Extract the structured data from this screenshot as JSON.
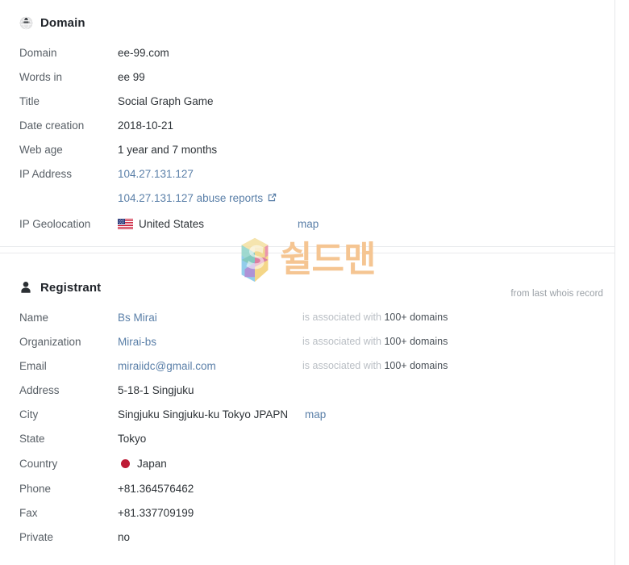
{
  "domain_section": {
    "title": "Domain",
    "icon": "globe-icon",
    "rows": [
      {
        "label": "Domain",
        "value": "ee-99.com"
      },
      {
        "label": "Words in",
        "value": "ee 99"
      },
      {
        "label": "Title",
        "value": "Social Graph Game"
      },
      {
        "label": "Date creation",
        "value": "2018-10-21"
      },
      {
        "label": "Web age",
        "value": "1 year and 7 months"
      }
    ],
    "ip": {
      "label": "IP Address",
      "address": "104.27.131.127",
      "abuse_link": "104.27.131.127 abuse reports",
      "external_icon": "external-link-icon"
    },
    "geolocation": {
      "label": "IP Geolocation",
      "country": "United States",
      "flag": "flag-united-states",
      "map_link": "map"
    }
  },
  "registrant_section": {
    "title": "Registrant",
    "icon": "user-icon",
    "note": "from last whois record",
    "associated_prefix": "is associated with",
    "associated_count": "100+ domains",
    "rows": [
      {
        "label": "Name",
        "value": "Bs Mirai",
        "link": true,
        "assoc": true
      },
      {
        "label": "Organization",
        "value": "Mirai-bs",
        "link": true,
        "assoc": true
      },
      {
        "label": "Email",
        "value": "miraiidc@gmail.com",
        "link": true,
        "assoc": true
      },
      {
        "label": "Address",
        "value": "5-18-1 Singjuku",
        "link": false,
        "assoc": false
      },
      {
        "label": "City",
        "value": "Singjuku Singjuku-ku Tokyo JPAPN",
        "link": false,
        "assoc": false,
        "map_link": "map"
      },
      {
        "label": "State",
        "value": "Tokyo",
        "link": false,
        "assoc": false
      },
      {
        "label": "Country",
        "value": "Japan",
        "link": false,
        "assoc": false,
        "flag": "flag-japan"
      },
      {
        "label": "Phone",
        "value": "+81.364576462",
        "link": false,
        "assoc": false
      },
      {
        "label": "Fax",
        "value": "+81.337709199",
        "link": false,
        "assoc": false
      },
      {
        "label": "Private",
        "value": "no",
        "link": false,
        "assoc": false
      }
    ]
  },
  "watermark": {
    "text": "쉴드맨",
    "logo": "shieldman-s-logo"
  },
  "colors": {
    "link": "#5a7fa8",
    "label": "#585f66",
    "value": "#2e3338",
    "muted": "#b9bec4",
    "divider": "#e9ebed",
    "watermark": "#f5c592"
  }
}
